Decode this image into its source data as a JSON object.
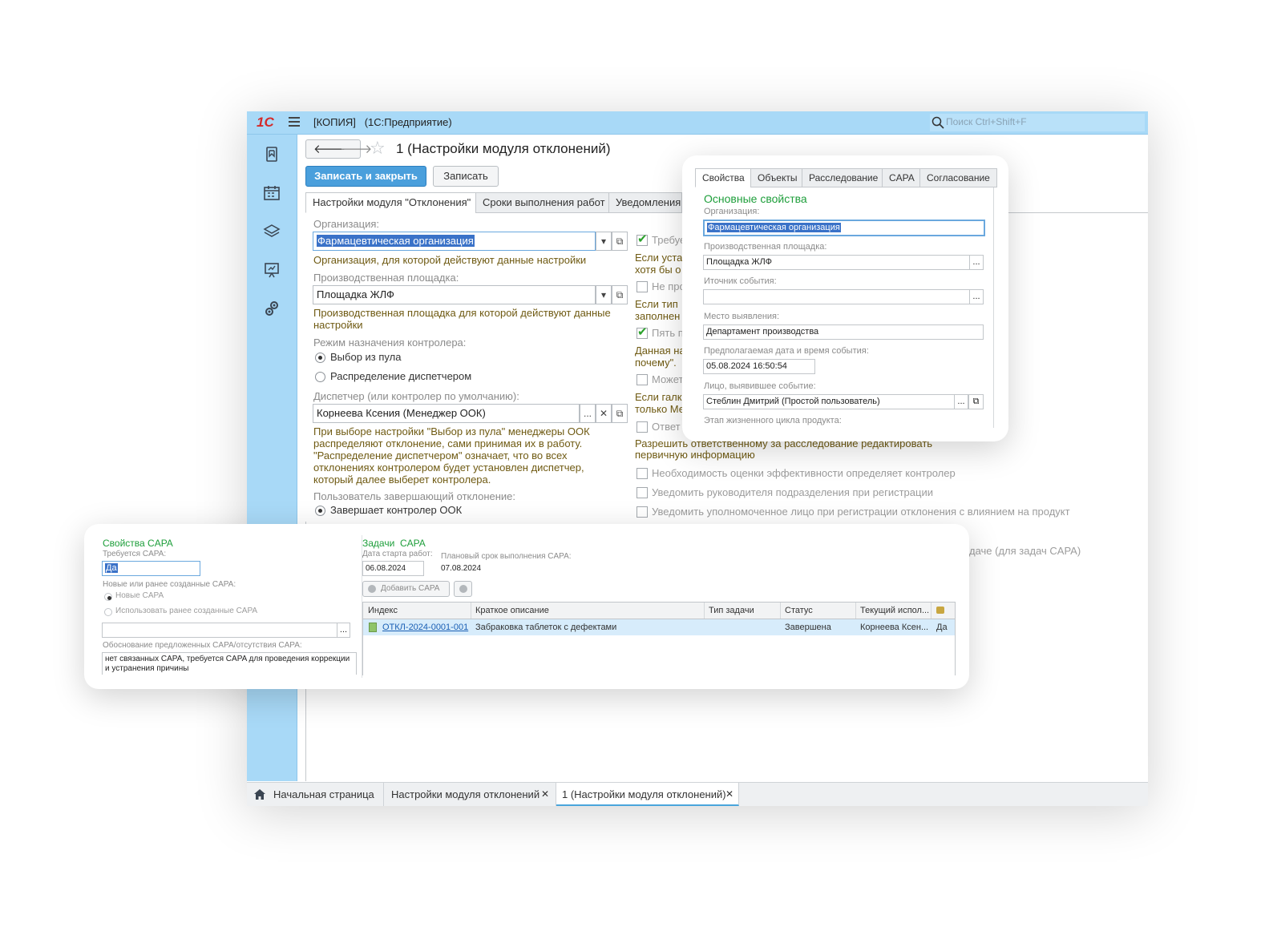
{
  "window": {
    "title_doc": "[КОПИЯ]",
    "title_app": "(1С:Предприятие)",
    "search_placeholder": "Поиск Ctrl+Shift+F",
    "logo": "1C"
  },
  "form": {
    "title": "1 (Настройки модуля отклонений)",
    "save_close": "Записать и закрыть",
    "save": "Записать",
    "tabs": [
      "Настройки модуля \"Отклонения\"",
      "Сроки выполнения работ",
      "Уведомления"
    ],
    "org_label": "Организация:",
    "org_value": "Фармацевтическая организация",
    "org_hint": "Организация, для которой действуют данные настройки",
    "site_label": "Производственная площадка:",
    "site_value": "Площадка ЖЛФ",
    "site_hint": "Производственная площадка для которой действуют данные настройки",
    "mode_label": "Режим назначения контролера:",
    "mode_pool": "Выбор из пула",
    "mode_dispatch": "Распределение диспетчером",
    "dispatcher_label": "Диспетчер (или контролер по умолчанию):",
    "dispatcher_value": "Корнеева Ксения (Менеджер ООК)",
    "dispatcher_hint": "При выборе настройки \"Выбор из пула\" менеджеры ООК распределяют отклонение, сами принимая их в работу. \"Распределение диспетчером\" означает, что во всех отклонениях  контролером будет установлен диспетчер, который далее выберет контролера.",
    "finisher_label": "Пользователь завершающий отклонение:",
    "finisher_value": "Завершает контролер ООК"
  },
  "right_col": {
    "c1": "Требуе",
    "c1_hint1": "Если уста",
    "c1_hint2": "хотя бы о",
    "c2": "Не про",
    "c2_hint1": "Если тип",
    "c2_hint2": "заполнен",
    "c3": "Пять п",
    "c3_hint1": "Данная на",
    "c3_hint2": "почему\".",
    "c4": "Может",
    "c4_hint1": "Если галк",
    "c4_hint2": "только Ме",
    "c5": "Ответ",
    "c5_hint1": "Разрешить ответственному за расследование редактировать",
    "c5_hint2": "первичную информацию",
    "c6": "Необходимость оценки эффективности определяет контролер",
    "c7": "Уведомить руководителя подразделения при регистрации",
    "c8": "Уведомить уполномоченное лицо при регистрации отклонения с влиянием на продукт",
    "c9_tail": "даче (для задач CAPA)"
  },
  "bottom_tabs": [
    "Начальная страница",
    "Настройки модуля отклонений",
    "1 (Настройки модуля отклонений)"
  ],
  "props_card": {
    "tabs": [
      "Свойства",
      "Объекты",
      "Расследование",
      "CAPA",
      "Согласование"
    ],
    "heading": "Основные свойства",
    "org_label": "Организация:",
    "org_value": "Фармацевтическая организация",
    "site_label": "Производственная площадка:",
    "site_value": "Площадка ЖЛФ",
    "source_label": "Иточник события:",
    "place_label": "Место выявления:",
    "place_value": "Департамент производства",
    "date_label": "Предполагаемая дата и время события:",
    "date_value": "05.08.2024 16:50:54",
    "person_label": "Лицо, выявившее событие:",
    "person_value": "Стеблин Дмитрий (Простой пользователь)",
    "stage_label": "Этап жизненного цикла продукта:"
  },
  "capa_card": {
    "props_heading": "Свойства CAPA",
    "required_label": "Требуется CAPA:",
    "required_value": "Да",
    "new_or_old_label": "Новые или ранее созданные CAPA:",
    "opt_new": "Новые CAPA",
    "opt_old": "Использовать ранее созданные CAPA",
    "reason_label": "Обоснование предложенных CAPA/отсутствия CAPA:",
    "reason_value": "нет связанных CAPA, требуется CAPA для проведения коррекции и устранения причины",
    "tasks_heading": "Задачи  CAPA",
    "start_label": "Дата старта работ:",
    "start_value": "06.08.2024",
    "plan_label": "Плановый срок выполнения CAPA:",
    "plan_value": "07.08.2024",
    "add_button": "Добавить CAPA",
    "columns": [
      "Индекс",
      "Краткое описание",
      "Тип задачи",
      "Статус",
      "Текущий испол...",
      ""
    ],
    "rows": [
      {
        "index": "ОТКЛ-2024-0001-001",
        "desc": "Забраковка таблеток с дефектами",
        "type": "",
        "status": "Завершена",
        "executor": "Корнеева Ксен...",
        "flag": "Да"
      }
    ]
  },
  "colors": {
    "accent": "#a8d9f7",
    "primary_button": "#4a9fdc",
    "heading_green": "#1d9e3a",
    "selection": "#3a72c8",
    "hint_brown": "#6f5a12"
  }
}
